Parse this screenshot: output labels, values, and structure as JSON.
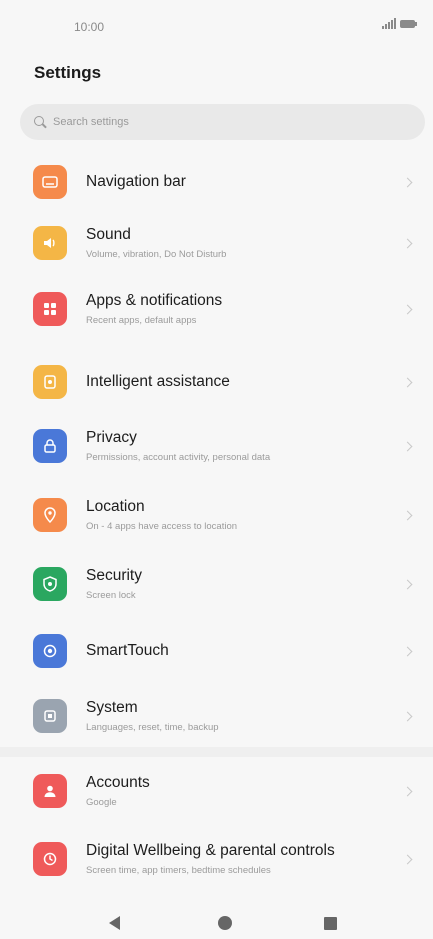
{
  "status_bar": {
    "time": "10:00"
  },
  "header": {
    "title": "Settings"
  },
  "search": {
    "placeholder": "Search settings"
  },
  "items": [
    {
      "id": "navigation-bar",
      "title": "Navigation bar",
      "subtitle": "",
      "icon": "navigation-icon",
      "color": "#f58a4b"
    },
    {
      "id": "sound",
      "title": "Sound",
      "subtitle": "Volume, vibration, Do Not Disturb",
      "icon": "sound-icon",
      "color": "#f4b646"
    },
    {
      "id": "apps-notifications",
      "title": "Apps & notifications",
      "subtitle": "Recent apps, default apps",
      "icon": "apps-icon",
      "color": "#ef5a5a"
    },
    {
      "id": "intelligent-assistance",
      "title": "Intelligent assistance",
      "subtitle": "",
      "icon": "assistance-icon",
      "color": "#f4b646"
    },
    {
      "id": "privacy",
      "title": "Privacy",
      "subtitle": "Permissions, account activity, personal data",
      "icon": "lock-icon",
      "color": "#4a78d8"
    },
    {
      "id": "location",
      "title": "Location",
      "subtitle": "On - 4 apps have access to location",
      "icon": "location-icon",
      "color": "#f58a4b"
    },
    {
      "id": "security",
      "title": "Security",
      "subtitle": "Screen lock",
      "icon": "shield-icon",
      "color": "#2aa760"
    },
    {
      "id": "smarttouch",
      "title": "SmartTouch",
      "subtitle": "",
      "icon": "smarttouch-icon",
      "color": "#4a78d8"
    },
    {
      "id": "system",
      "title": "System",
      "subtitle": "Languages, reset, time, backup",
      "icon": "system-icon",
      "color": "#9aa4b0"
    },
    {
      "id": "accounts",
      "title": "Accounts",
      "subtitle": "Google",
      "icon": "account-icon",
      "color": "#ef5a5a"
    },
    {
      "id": "digital-wellbeing",
      "title": "Digital Wellbeing & parental controls",
      "subtitle": "Screen time, app timers, bedtime schedules",
      "icon": "wellbeing-icon",
      "color": "#ef5a5a"
    }
  ]
}
